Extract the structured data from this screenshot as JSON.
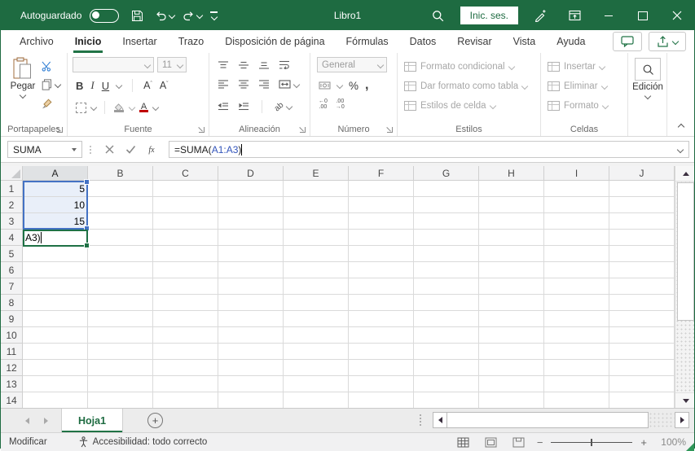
{
  "colors": {
    "excel_green": "#217346",
    "titlebar_green": "#1E6B41",
    "range_border_blue": "#4472C4",
    "range_fill_blue": "#E9EFF9",
    "formula_reference_blue": "#3355BB",
    "active_cell_green": "#1E7145"
  },
  "title_bar": {
    "autosave_label": "Autoguardado",
    "autosave_state": "off",
    "document_title": "Libro1",
    "signin_label": "Inic. ses."
  },
  "ribbon_tabs": [
    {
      "label": "Archivo",
      "active": false
    },
    {
      "label": "Inicio",
      "active": true
    },
    {
      "label": "Insertar",
      "active": false
    },
    {
      "label": "Trazo",
      "active": false
    },
    {
      "label": "Disposición de página",
      "active": false
    },
    {
      "label": "Fórmulas",
      "active": false
    },
    {
      "label": "Datos",
      "active": false
    },
    {
      "label": "Revisar",
      "active": false
    },
    {
      "label": "Vista",
      "active": false
    },
    {
      "label": "Ayuda",
      "active": false
    }
  ],
  "ribbon": {
    "clipboard": {
      "paste_label": "Pegar",
      "group_label": "Portapapeles"
    },
    "font": {
      "group_label": "Fuente",
      "font_name_value": "",
      "font_size_value": "11",
      "bold_label": "B",
      "italic_label": "I",
      "underline_label": "U",
      "grow_font_label": "A",
      "shrink_font_label": "A",
      "font_color_label": "A"
    },
    "alignment": {
      "group_label": "Alineación",
      "orientation_label": "ab"
    },
    "number": {
      "group_label": "Número",
      "format_value": "General",
      "percent_label": "%",
      "comma_label": ",",
      "inc_decimal_text": "←0\n.00",
      "dec_decimal_text": ".00\n→0"
    },
    "styles": {
      "group_label": "Estilos",
      "items": [
        {
          "label": "Formato condicional"
        },
        {
          "label": "Dar formato como tabla"
        },
        {
          "label": "Estilos de celda"
        }
      ]
    },
    "cells": {
      "group_label": "Celdas",
      "items": [
        {
          "label": "Insertar"
        },
        {
          "label": "Eliminar"
        },
        {
          "label": "Formato"
        }
      ]
    },
    "editing": {
      "group_label": "Edición"
    }
  },
  "formula_bar": {
    "name_box_value": "SUMA",
    "fx_label": "f",
    "fx_sub": "x",
    "formula_prefix": "=SUMA(",
    "formula_reference": "A1:A3",
    "formula_suffix": ")"
  },
  "grid": {
    "columns": [
      "A",
      "B",
      "C",
      "D",
      "E",
      "F",
      "G",
      "H",
      "I",
      "J"
    ],
    "visible_rows": 14,
    "selected_column": "A",
    "highlighted_range": "A1:A3",
    "active_cell": "A4",
    "cells": {
      "A1": "5",
      "A2": "10",
      "A3": "15",
      "A4": "A3)"
    }
  },
  "sheet_bar": {
    "sheet_tab_label": "Hoja1",
    "add_sheet_label": "+"
  },
  "status_bar": {
    "mode_label": "Modificar",
    "accessibility_label": "Accesibilidad: todo correcto",
    "zoom_value": "100%"
  }
}
